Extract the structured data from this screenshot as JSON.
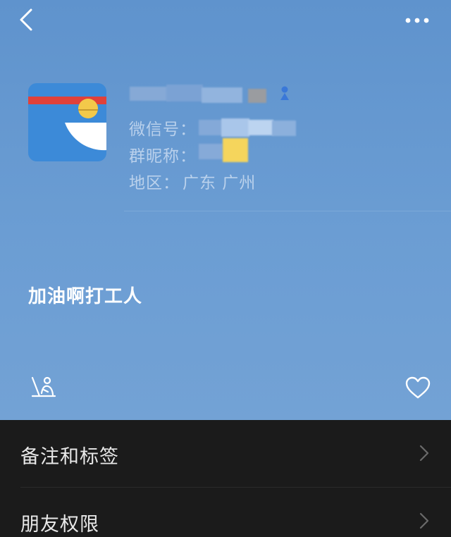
{
  "header": {
    "back_icon": "chevron-left-icon",
    "more_icon": "more-dots-icon"
  },
  "profile": {
    "avatar_icon": "doraemon-avatar",
    "nickname": "",
    "wechat_id_label": "微信号：",
    "wechat_id_value": "",
    "group_nickname_label": "群昵称：",
    "group_nickname_value": "",
    "region_label": "地区：",
    "region_value": "广东  广州"
  },
  "signature": "加油啊打工人",
  "actions": {
    "album_icon": "moments-album-icon",
    "like_icon": "heart-icon"
  },
  "menu": {
    "items": [
      {
        "label": "备注和标签"
      },
      {
        "label": "朋友权限"
      }
    ]
  },
  "colors": {
    "hero_background": "#6b9dd3",
    "menu_background": "#1b1b1b",
    "avatar_blue": "#3c8ad8",
    "avatar_red": "#e0413a",
    "avatar_yellow": "#f3c94a"
  }
}
